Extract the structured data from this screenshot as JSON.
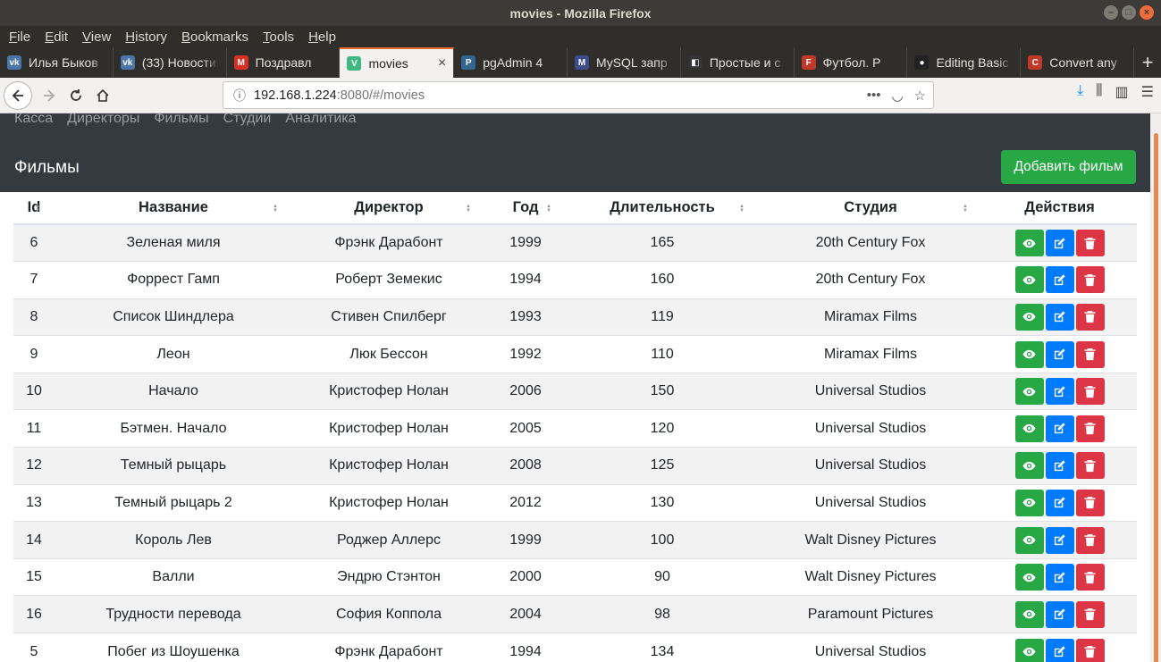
{
  "window": {
    "title": "movies - Mozilla Firefox"
  },
  "menu": [
    "File",
    "Edit",
    "View",
    "History",
    "Bookmarks",
    "Tools",
    "Help"
  ],
  "tabs": [
    {
      "label": "Илья Быков",
      "icon": "vk-icon",
      "color": "#4a76a8"
    },
    {
      "label": "(33) Новости",
      "icon": "vk-icon",
      "color": "#4a76a8"
    },
    {
      "label": "Поздравл",
      "icon": "gmail-icon",
      "color": "#d93025"
    },
    {
      "label": "movies",
      "icon": "vue-icon",
      "color": "#41b883",
      "active": true
    },
    {
      "label": "pgAdmin 4",
      "icon": "postgres-icon",
      "color": "#336791"
    },
    {
      "label": "MySQL запр",
      "icon": "mysql-icon",
      "color": "#3e4d8a"
    },
    {
      "label": "Простые и с",
      "icon": "bookmark-icon",
      "color": "#333"
    },
    {
      "label": "Футбол. Р",
      "icon": "football-icon",
      "color": "#c0392b"
    },
    {
      "label": "Editing Basic",
      "icon": "github-icon",
      "color": "#222"
    },
    {
      "label": "Convert any",
      "icon": "convert-icon",
      "color": "#c0392b"
    }
  ],
  "url": {
    "host": "192.168.1.224",
    "rest": ":8080/#/movies"
  },
  "app": {
    "nav": [
      "Касса",
      "Директоры",
      "Фильмы",
      "Студии",
      "Аналитика"
    ],
    "title": "Фильмы",
    "add_button": "Добавить фильм"
  },
  "table": {
    "headers": [
      "Id",
      "Название",
      "Директор",
      "Год",
      "Длительность",
      "Студия",
      "Действия"
    ],
    "rows": [
      [
        "6",
        "Зеленая миля",
        "Фрэнк Дарабонт",
        "1999",
        "165",
        "20th Century Fox"
      ],
      [
        "7",
        "Форрест Гамп",
        "Роберт Земекис",
        "1994",
        "160",
        "20th Century Fox"
      ],
      [
        "8",
        "Список Шиндлера",
        "Стивен Спилберг",
        "1993",
        "119",
        "Miramax Films"
      ],
      [
        "9",
        "Леон",
        "Люк Бессон",
        "1992",
        "110",
        "Miramax Films"
      ],
      [
        "10",
        "Начало",
        "Кристофер Нолан",
        "2006",
        "150",
        "Universal Studios"
      ],
      [
        "11",
        "Бэтмен. Начало",
        "Кристофер Нолан",
        "2005",
        "120",
        "Universal Studios"
      ],
      [
        "12",
        "Темный рыцарь",
        "Кристофер Нолан",
        "2008",
        "125",
        "Universal Studios"
      ],
      [
        "13",
        "Темный рыцарь 2",
        "Кристофер Нолан",
        "2012",
        "130",
        "Universal Studios"
      ],
      [
        "14",
        "Король Лев",
        "Роджер Аллерс",
        "1999",
        "100",
        "Walt Disney Pictures"
      ],
      [
        "15",
        "Валли",
        "Эндрю Стэнтон",
        "2000",
        "90",
        "Walt Disney Pictures"
      ],
      [
        "16",
        "Трудности перевода",
        "София Коппола",
        "2004",
        "98",
        "Paramount Pictures"
      ],
      [
        "5",
        "Побег из Шоушенка",
        "Фрэнк Дарабонт",
        "1994",
        "134",
        "Universal Studios"
      ]
    ]
  }
}
